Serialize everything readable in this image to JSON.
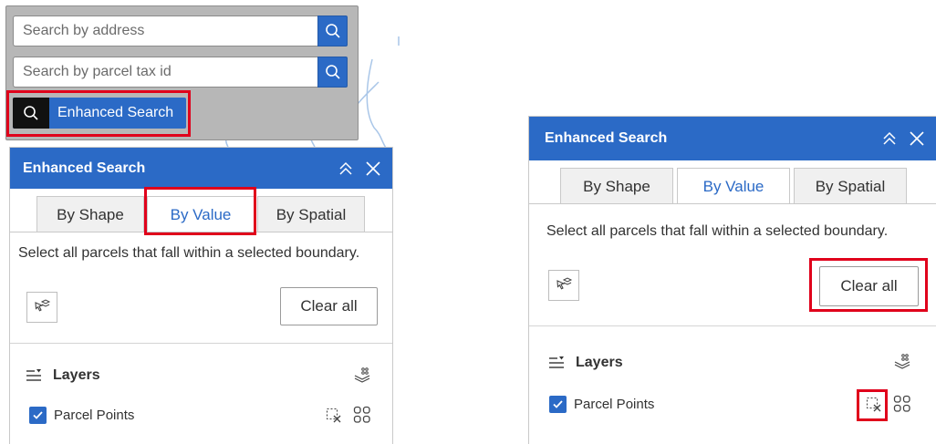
{
  "search": {
    "address_placeholder": "Search by address",
    "parcel_placeholder": "Search by parcel tax id",
    "enhanced_label": "Enhanced Search"
  },
  "panel_left": {
    "title": "Enhanced Search",
    "tabs": [
      "By Shape",
      "By Value",
      "By Spatial"
    ],
    "active_tab": "By Value",
    "description": "Select all parcels that fall within a selected boundary.",
    "clear_label": "Clear all",
    "layers_title": "Layers",
    "layer_name": "Parcel Points"
  },
  "panel_right": {
    "title": "Enhanced Search",
    "tabs": [
      "By Shape",
      "By Value",
      "By Spatial"
    ],
    "active_tab": "By Value",
    "description": "Select all parcels that fall within a selected boundary.",
    "clear_label": "Clear all",
    "layers_title": "Layers",
    "layer_name": "Parcel Points"
  },
  "colors": {
    "accent": "#2b6ac6",
    "highlight": "#e0001b",
    "search_bg": "#b7b7b7"
  },
  "icons": [
    "search-icon",
    "collapse-icon",
    "close-icon",
    "select-tool-icon",
    "layers-list-icon",
    "layers-stack-icon",
    "clear-selection-icon",
    "grid-icon",
    "checkbox-icon"
  ]
}
